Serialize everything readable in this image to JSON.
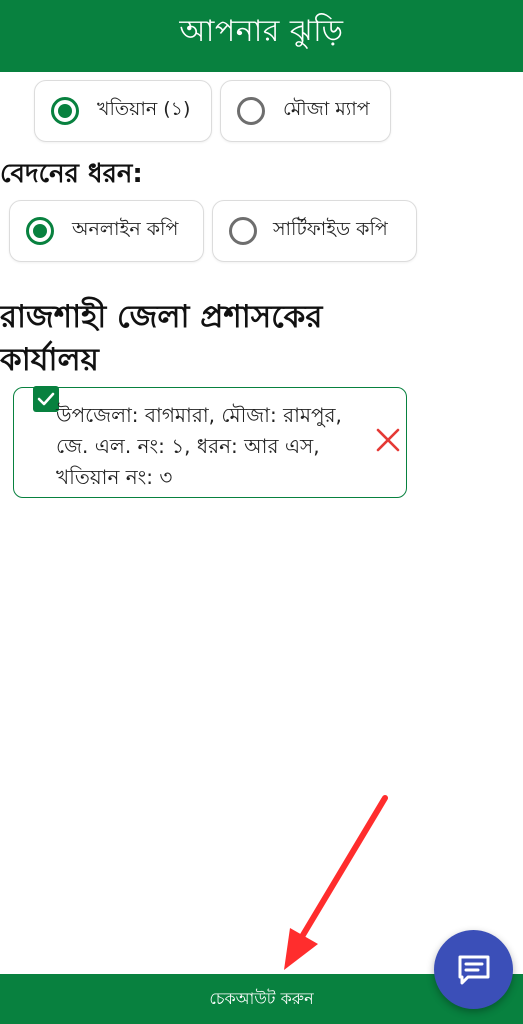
{
  "header": {
    "title": "আপনার ঝুড়ি"
  },
  "record_type": {
    "options": [
      {
        "label": "খতিয়ান (১)",
        "selected": true
      },
      {
        "label": "মৌজা ম্যাপ",
        "selected": false
      }
    ]
  },
  "application_type": {
    "label": "বেদনের ধরন:",
    "options": [
      {
        "label": "অনলাইন কপি",
        "selected": true
      },
      {
        "label": "সার্টিফাইড কপি",
        "selected": false
      }
    ]
  },
  "office": {
    "name": "রাজশাহী জেলা প্রশাসকের কার্যালয়"
  },
  "cart_item": {
    "checked": true,
    "description": "উপজেলা: বাগমারা, মৌজা: রামপুর, জে. এল. নং: ১, ধরন: আর এস, খতিয়ান নং: ৩"
  },
  "footer": {
    "checkout_label": "চেকআউট করুন"
  },
  "fab": {
    "icon": "chat-icon"
  },
  "colors": {
    "primary": "#08813f",
    "fab": "#3b4fb8",
    "remove": "#e53935",
    "annotation_arrow": "#ff2d2d"
  }
}
